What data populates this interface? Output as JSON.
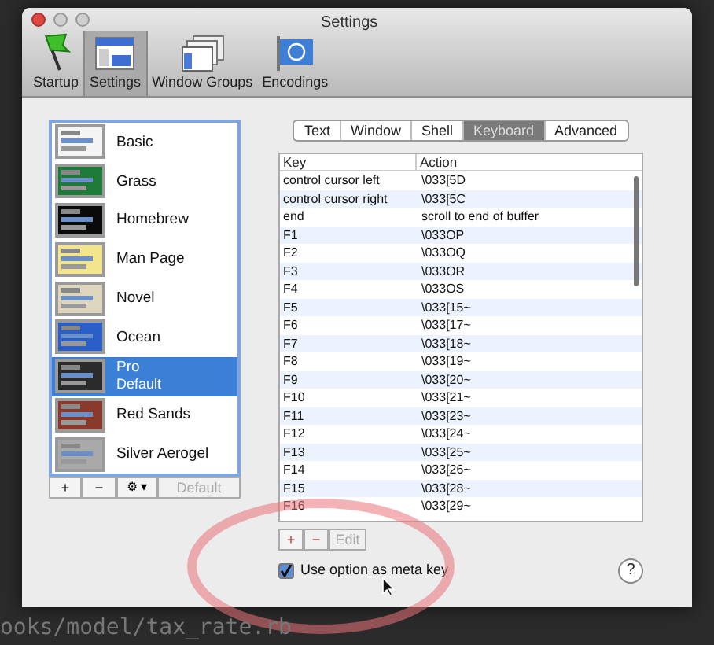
{
  "background_text": {
    "bottom_line": "ooks/model/tax_rate.rb"
  },
  "window": {
    "title": "Settings"
  },
  "toolbar": [
    {
      "label": "Startup",
      "kind": "flag",
      "selected": false
    },
    {
      "label": "Settings",
      "kind": "settings",
      "selected": true
    },
    {
      "label": "Window Groups",
      "kind": "windows",
      "selected": false
    },
    {
      "label": "Encodings",
      "kind": "globe",
      "selected": false
    }
  ],
  "profiles": [
    {
      "name": "Basic",
      "color": "#f4f4f4",
      "selected": false
    },
    {
      "name": "Grass",
      "color": "#1f7a3a",
      "selected": false
    },
    {
      "name": "Homebrew",
      "color": "#0a0a0a",
      "selected": false
    },
    {
      "name": "Man Page",
      "color": "#f3e58e",
      "selected": false
    },
    {
      "name": "Novel",
      "color": "#ddd6bd",
      "selected": false
    },
    {
      "name": "Ocean",
      "color": "#2a5fc8",
      "selected": false
    },
    {
      "name": "Pro",
      "subtitle": "Default",
      "color": "#2b2b2b",
      "selected": true
    },
    {
      "name": "Red Sands",
      "color": "#8a3a2a",
      "selected": false
    },
    {
      "name": "Silver Aerogel",
      "color": "#a9a9a9",
      "selected": false
    }
  ],
  "profile_buttons": {
    "add": "+",
    "remove": "−",
    "gear": "⚙ ▾",
    "default": "Default",
    "default_disabled": true
  },
  "tabs": [
    {
      "label": "Text",
      "selected": false
    },
    {
      "label": "Window",
      "selected": false
    },
    {
      "label": "Shell",
      "selected": false
    },
    {
      "label": "Keyboard",
      "selected": true
    },
    {
      "label": "Advanced",
      "selected": false
    }
  ],
  "table": {
    "columns": [
      "Key",
      "Action"
    ],
    "rows": [
      [
        "control cursor left",
        "\\033[5D"
      ],
      [
        "control cursor right",
        "\\033[5C"
      ],
      [
        "end",
        "scroll to end of buffer"
      ],
      [
        "F1",
        "\\033OP"
      ],
      [
        "F2",
        "\\033OQ"
      ],
      [
        "F3",
        "\\033OR"
      ],
      [
        "F4",
        "\\033OS"
      ],
      [
        "F5",
        "\\033[15~"
      ],
      [
        "F6",
        "\\033[17~"
      ],
      [
        "F7",
        "\\033[18~"
      ],
      [
        "F8",
        "\\033[19~"
      ],
      [
        "F9",
        "\\033[20~"
      ],
      [
        "F10",
        "\\033[21~"
      ],
      [
        "F11",
        "\\033[23~"
      ],
      [
        "F12",
        "\\033[24~"
      ],
      [
        "F13",
        "\\033[25~"
      ],
      [
        "F14",
        "\\033[26~"
      ],
      [
        "F15",
        "\\033[28~"
      ],
      [
        "F16",
        "\\033[29~"
      ]
    ]
  },
  "table_buttons": {
    "add": "+",
    "remove": "−",
    "edit": "Edit",
    "edit_disabled": true
  },
  "option_meta": {
    "label": "Use option as meta key",
    "checked": true
  },
  "help": "?"
}
